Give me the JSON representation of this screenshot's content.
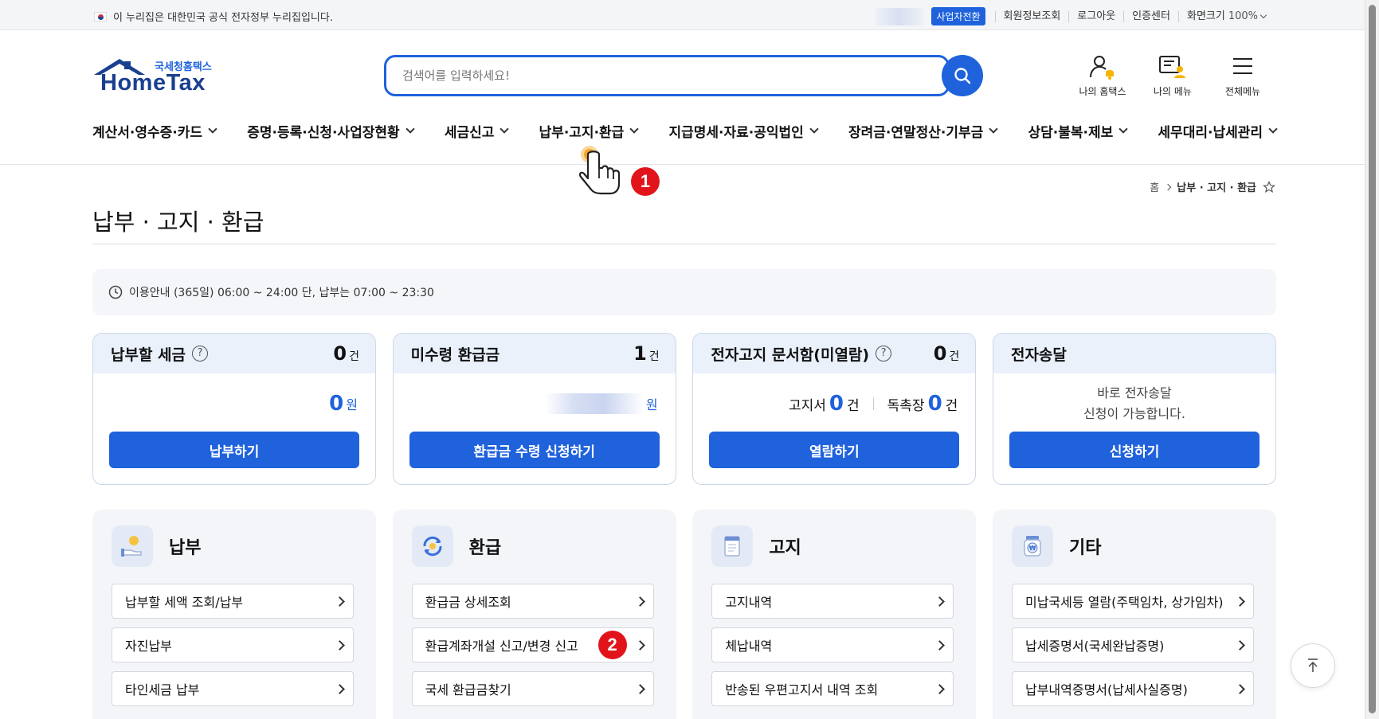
{
  "utility": {
    "gov_notice": "이 누리집은 대한민국 공식 전자정부 누리집입니다.",
    "biz_switch": "사업자전환",
    "links": [
      "회원정보조회",
      "로그아웃",
      "인증센터"
    ],
    "zoom_label": "화면크기",
    "zoom_value": "100%"
  },
  "logo": {
    "sub": "국세청홈택스",
    "main": "HomeTax"
  },
  "search": {
    "placeholder": "검색어를 입력하세요!"
  },
  "header_icons": {
    "my_hometax": "나의 홈택스",
    "my_menu": "나의 메뉴",
    "all_menu": "전체메뉴"
  },
  "nav": {
    "items": [
      "계산서·영수증·카드",
      "증명·등록·신청·사업장현황",
      "세금신고",
      "납부·고지·환급",
      "지급명세·자료·공익법인",
      "장려금·연말정산·기부금",
      "상담·불복·제보",
      "세무대리·납세관리"
    ]
  },
  "step_marks": {
    "one": "1",
    "two": "2"
  },
  "breadcrumb": {
    "home": "홈",
    "current": "납부 · 고지 · 환급"
  },
  "page": {
    "title": "납부 · 고지 · 환급"
  },
  "notice": {
    "text": "이용안내 (365일) 06:00 ~ 24:00 단, 납부는 07:00 ~ 23:30"
  },
  "cards": {
    "tax_due": {
      "title": "납부할 세금",
      "count": "0",
      "count_unit": "건",
      "amount": "0",
      "amount_unit": "원",
      "button": "납부하기"
    },
    "refund": {
      "title": "미수령 환급금",
      "count": "1",
      "count_unit": "건",
      "amount_unit": "원",
      "button": "환급금 수령 신청하기"
    },
    "enotice": {
      "title": "전자고지 문서함(미열람)",
      "count": "0",
      "count_unit": "건",
      "bill_label": "고지서",
      "bill_count": "0",
      "bill_unit": "건",
      "urge_label": "독촉장",
      "urge_count": "0",
      "urge_unit": "건",
      "button": "열람하기"
    },
    "esend": {
      "title": "전자송달",
      "line1": "바로 전자송달",
      "line2": "신청이 가능합니다.",
      "button": "신청하기"
    }
  },
  "categories": {
    "payment": {
      "title": "납부",
      "items": [
        "납부할 세액 조회/납부",
        "자진납부",
        "타인세금 납부"
      ]
    },
    "refund": {
      "title": "환급",
      "items": [
        "환급금 상세조회",
        "환급계좌개설 신고/변경 신고",
        "국세 환급금찾기"
      ]
    },
    "notice": {
      "title": "고지",
      "items": [
        "고지내역",
        "체납내역",
        "반송된 우편고지서 내역 조회"
      ]
    },
    "other": {
      "title": "기타",
      "items": [
        "미납국세등 열람(주택임차, 상가임차)",
        "납세증명서(국세완납증명)",
        "납부내역증명서(납세사실증명)"
      ]
    }
  },
  "colors": {
    "primary": "#1f62dc",
    "card_head": "#eaf1fb",
    "mark": "#e2141b"
  }
}
